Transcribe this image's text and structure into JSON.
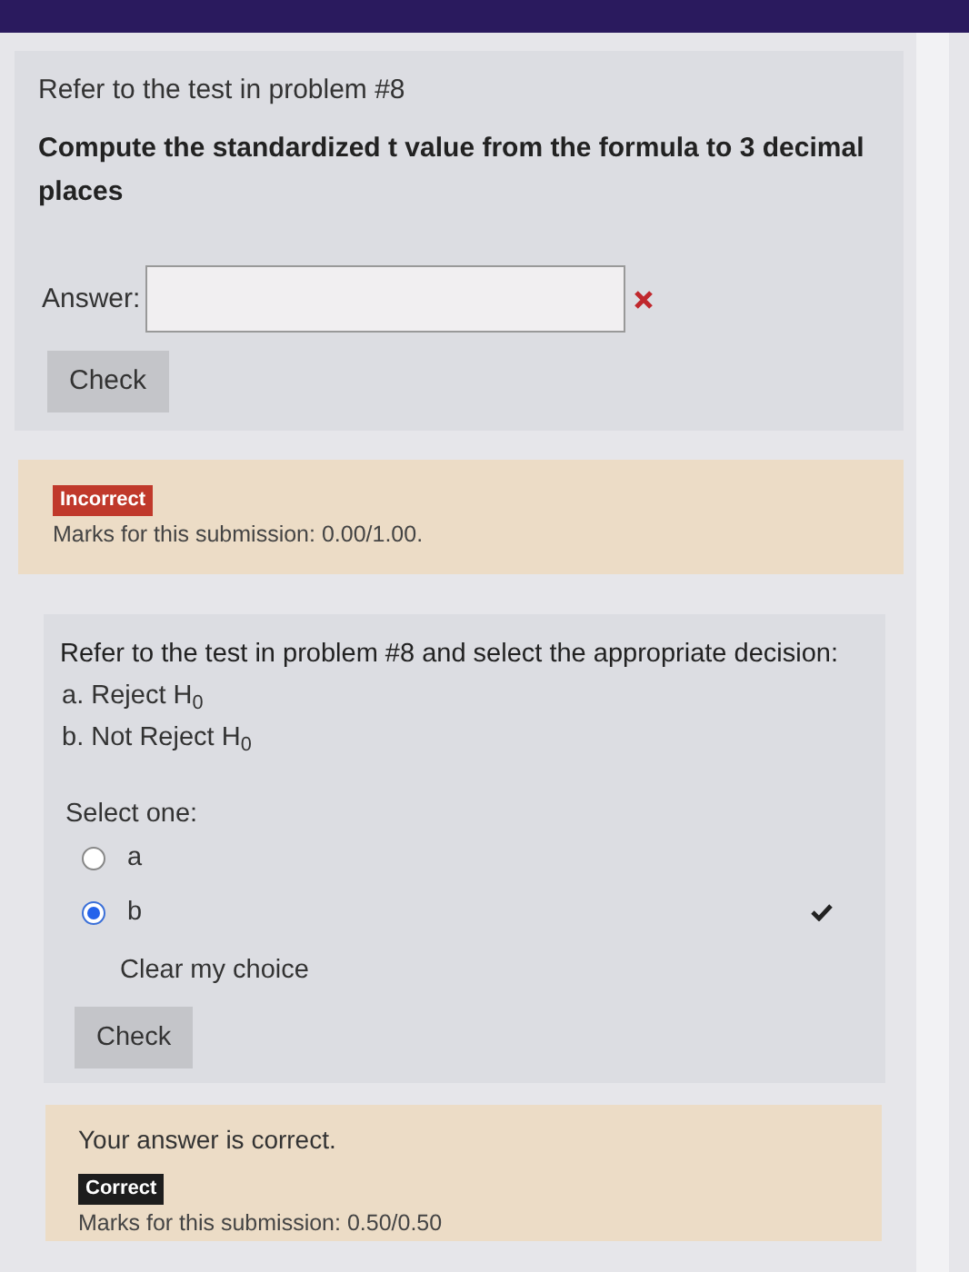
{
  "questions": [
    {
      "kind": "numeric",
      "intro": "Refer to the test in problem #8",
      "prompt": "Compute the standardized t value from the formula to 3 decimal places",
      "answer_label": "Answer:",
      "correct": false,
      "check_button": "Check",
      "feedback": {
        "status": "Incorrect",
        "correct": false,
        "marks": "Marks for this submission: 0.00/1.00."
      }
    },
    {
      "kind": "choice",
      "prompt": "Refer to the test in problem #8 and select the appropriate decision:",
      "option_lines": [
        "a. Reject H$_{0}$",
        "b. Not Reject H$_{0}$"
      ],
      "select_label": "Select one:",
      "choices": [
        {
          "label": "a",
          "selected": false
        },
        {
          "label": "b",
          "selected": true,
          "correct": true
        }
      ],
      "clear_link": "Clear my choice",
      "check_button": "Check",
      "feedback": {
        "message": "Your answer is correct.",
        "status": "Correct",
        "correct": true,
        "marks": "Marks for this submission: 0.50/0.50"
      }
    }
  ]
}
